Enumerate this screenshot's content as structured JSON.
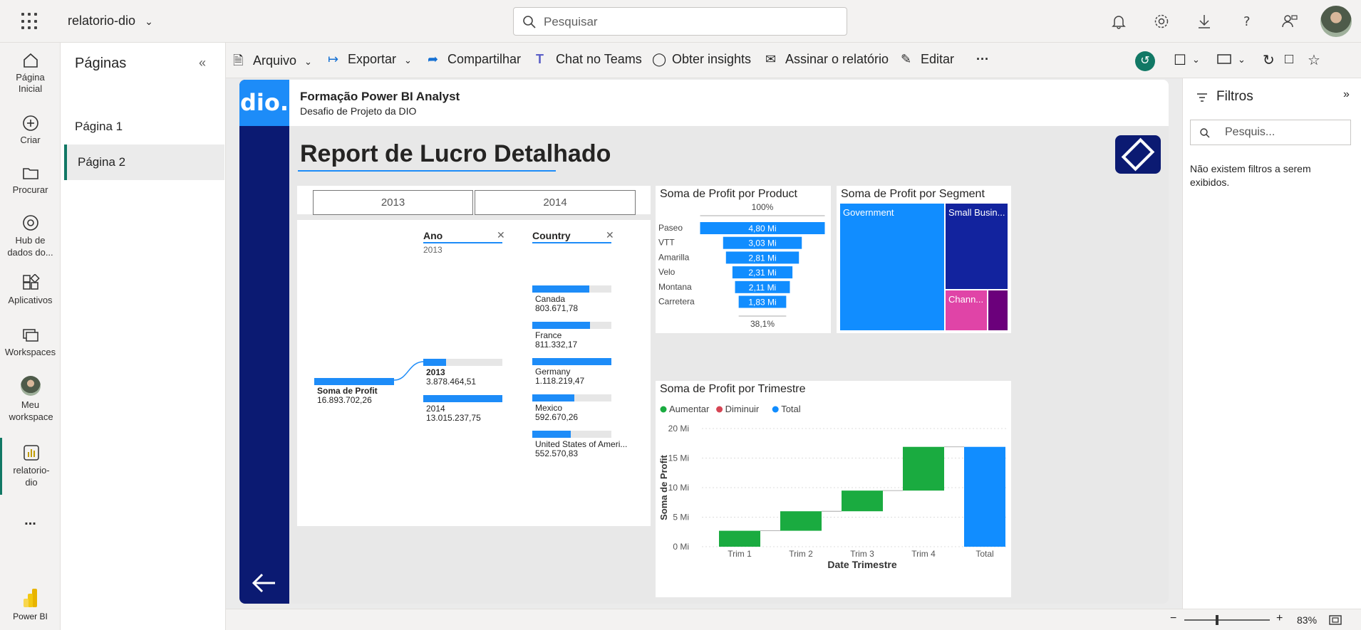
{
  "app": {
    "title": "relatorio-dio",
    "search_placeholder": "Pesquisar"
  },
  "leftnav": {
    "items": [
      "Página Inicial",
      "Criar",
      "Procurar",
      "Hub de dados do...",
      "Aplicativos",
      "Workspaces",
      "Meu workspace",
      "relatorio-dio"
    ],
    "more": "...",
    "product": "Power BI"
  },
  "pages": {
    "title": "Páginas",
    "items": [
      "Página 1",
      "Página 2"
    ],
    "selected": 1
  },
  "toolbar": {
    "arquivo": "Arquivo",
    "exportar": "Exportar",
    "compartilhar": "Compartilhar",
    "teams": "Chat no Teams",
    "insights": "Obter insights",
    "assinar": "Assinar o relatório",
    "editar": "Editar",
    "more": "···"
  },
  "report": {
    "header_title": "Formação Power BI Analyst",
    "header_sub": "Desafio de Projeto da DIO",
    "logo": "dio.",
    "title": "Report de Lucro Detalhado",
    "slicer": [
      "2013",
      "2014"
    ],
    "decomp": {
      "root_label": "Soma de Profit",
      "root_value": "16.893.702,26",
      "col1_head": "Ano",
      "col1_filter": "2013",
      "col2_head": "Country",
      "years": [
        {
          "label": "2013",
          "value": "3.878.464,51",
          "fill": 0.29
        },
        {
          "label": "2014",
          "value": "13.015.237,75",
          "fill": 1.0
        }
      ],
      "countries": [
        {
          "label": "Canada",
          "value": "803.671,78",
          "fill": 0.72
        },
        {
          "label": "France",
          "value": "811.332,17",
          "fill": 0.73
        },
        {
          "label": "Germany",
          "value": "1.118.219,47",
          "fill": 1.0
        },
        {
          "label": "Mexico",
          "value": "592.670,26",
          "fill": 0.53
        },
        {
          "label": "United States of Ameri...",
          "value": "552.570,83",
          "fill": 0.49
        }
      ]
    }
  },
  "chart_data": [
    {
      "type": "bar",
      "title": "Soma de Profit por Product",
      "categories": [
        "Paseo",
        "VTT",
        "Amarilla",
        "Velo",
        "Montana",
        "Carretera"
      ],
      "values": [
        4.8,
        3.03,
        2.81,
        2.31,
        2.11,
        1.83
      ],
      "value_labels": [
        "4,80 Mi",
        "3,03 Mi",
        "2,81 Mi",
        "2,31 Mi",
        "2,11 Mi",
        "1,83 Mi"
      ],
      "top_pct": "100%",
      "bottom_pct": "38,1%"
    },
    {
      "type": "heatmap",
      "title": "Soma de Profit por Segment",
      "segments": [
        {
          "name": "Government",
          "color": "#118DFF"
        },
        {
          "name": "Small Busin...",
          "color": "#12239E"
        },
        {
          "name": "Chann...",
          "color": "#E044A7"
        },
        {
          "name": "",
          "color": "#6B007B"
        }
      ]
    },
    {
      "type": "bar",
      "title": "Soma de Profit por Trimestre",
      "legend": [
        "Aumentar",
        "Diminuir",
        "Total"
      ],
      "legend_colors": [
        "#1AAB40",
        "#D64554",
        "#118DFF"
      ],
      "categories": [
        "Trim 1",
        "Trim 2",
        "Trim 3",
        "Trim 4",
        "Total"
      ],
      "steps": [
        [
          0,
          2.7
        ],
        [
          2.7,
          6.0
        ],
        [
          6.0,
          9.5
        ],
        [
          9.5,
          16.9
        ],
        [
          0,
          16.9
        ]
      ],
      "xlabel": "Date Trimestre",
      "ylabel": "Soma de Profit",
      "yticks": [
        "0 Mi",
        "5 Mi",
        "10 Mi",
        "15 Mi",
        "20 Mi"
      ],
      "ylim": [
        0,
        20
      ]
    }
  ],
  "filters": {
    "title": "Filtros",
    "search": "Pesquis...",
    "empty": "Não existem filtros a serem exibidos."
  },
  "status": {
    "zoom": "83%"
  }
}
